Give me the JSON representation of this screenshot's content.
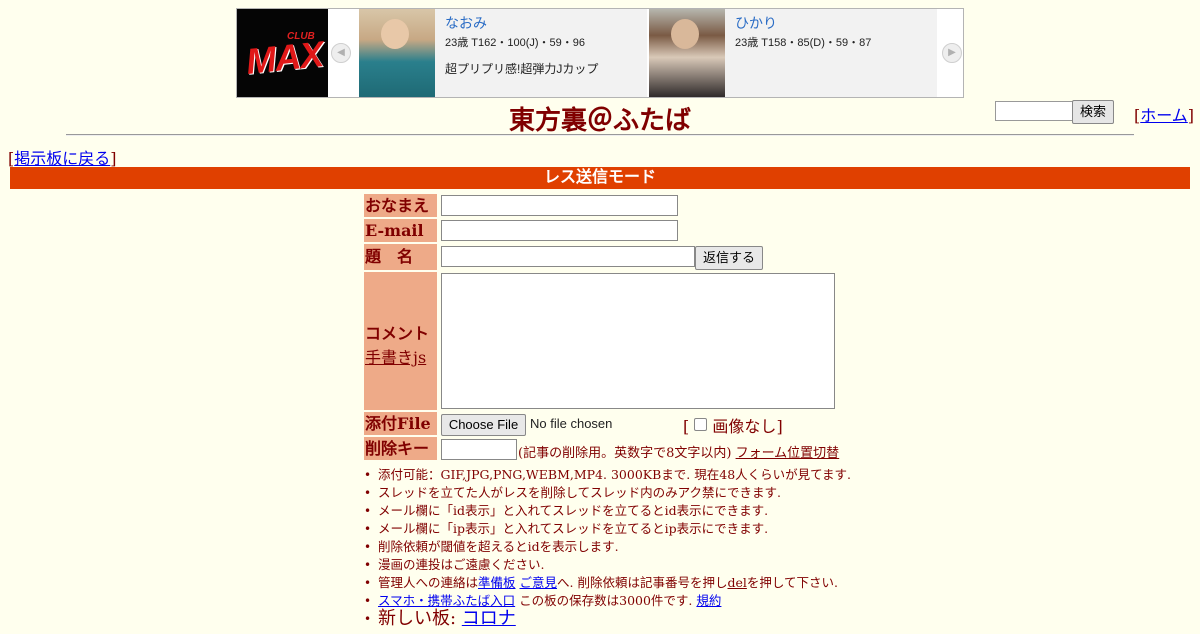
{
  "banner": {
    "logo_top": "CLUB",
    "logo_main": "MAX",
    "prev_arrow": "◀",
    "next_arrow": "▶",
    "cards": [
      {
        "name": "なおみ",
        "stats": "23歳 T162・100(J)・59・96",
        "comment": "超プリプリ感!超弾力Jカップ"
      },
      {
        "name": "ひかり",
        "stats": "23歳 T158・85(D)・59・87",
        "comment": ""
      }
    ]
  },
  "header": {
    "title": "東方裏＠ふたば",
    "search_placeholder": "",
    "search_button": "検索",
    "home_link": "ホーム"
  },
  "nav": {
    "back_link": "掲示板に戻る"
  },
  "mode_bar": "レス送信モード",
  "form": {
    "name_label": "おなまえ",
    "email_label": "E-mail",
    "subject_label": "題　名",
    "submit_button": "返信する",
    "comment_label": "コメント",
    "tegaki_link": "手書きjs",
    "file_label": "添付File",
    "choose_file": "Choose File",
    "no_file": "No file chosen",
    "no_image_label": "画像なし",
    "delkey_label": "削除キー",
    "delkey_note": "(記事の削除用。英数字で8文字以内)",
    "switch_link": "フォーム位置切替"
  },
  "notes": {
    "n1": "添付可能：GIF,JPG,PNG,WEBM,MP4. 3000KBまで. 現在48人くらいが見てます.",
    "n2": "スレッドを立てた人がレスを削除してスレッド内のみアク禁にできます.",
    "n3": "メール欄に「id表示」と入れてスレッドを立てるとid表示にできます.",
    "n4": "メール欄に「ip表示」と入れてスレッドを立てるとip表示にできます.",
    "n5": "削除依頼が閾値を超えるとidを表示します.",
    "n6": "漫画の連投はご遠慮ください.",
    "n7_pre": "管理人への連絡は",
    "n7_link1": "準備板",
    "n7_link2": "ご意見",
    "n7_mid": "へ. 削除依頼は記事番号を押し",
    "n7_del": "del",
    "n7_post": "を押して下さい.",
    "n8_link": "スマホ・携帯ふたば入口",
    "n8_mid": "この板の保存数は3000件です.",
    "n8_rules": "規約",
    "n9_pre": "新しい板: ",
    "n9_link": "コロナ"
  }
}
